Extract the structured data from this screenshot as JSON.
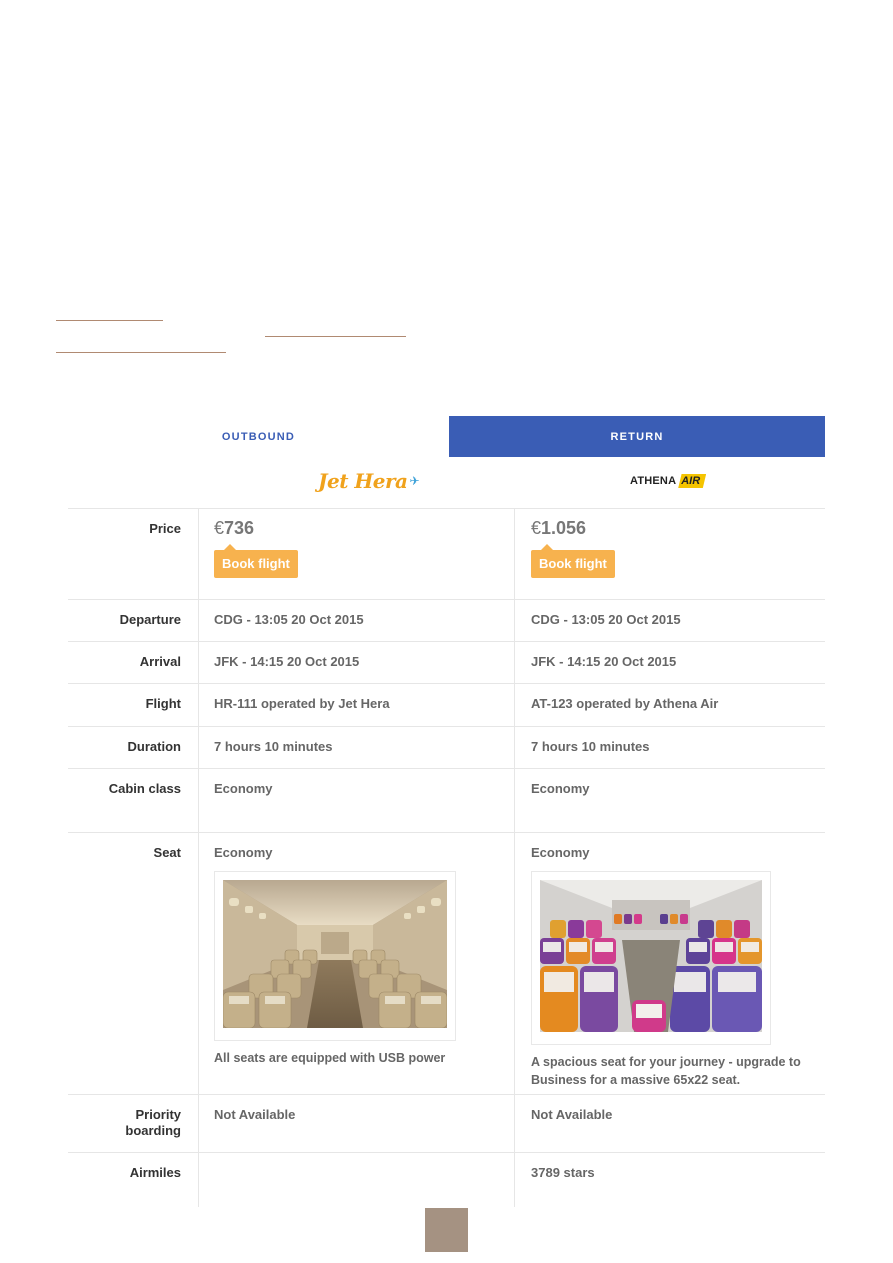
{
  "tabs": {
    "outbound": "OUTBOUND",
    "return": "RETURN"
  },
  "airlines": {
    "jet_hera": "Jet Hera",
    "athena_main": "ATHENA",
    "athena_accent": "AIR"
  },
  "rows": {
    "price": {
      "label": "Price",
      "col1_currency": "€",
      "col1_amount": "736",
      "col2_currency": "€",
      "col2_amount": "1.056",
      "book_label": "Book flight"
    },
    "departure": {
      "label": "Departure",
      "col1": "CDG - 13:05 20 Oct 2015",
      "col2": "CDG - 13:05 20 Oct 2015"
    },
    "arrival": {
      "label": "Arrival",
      "col1": "JFK - 14:15 20 Oct 2015",
      "col2": "JFK - 14:15 20 Oct 2015"
    },
    "flight": {
      "label": "Flight",
      "col1": "HR-111 operated by Jet Hera",
      "col2": "AT-123 operated by Athena Air"
    },
    "duration": {
      "label": "Duration",
      "col1": "7 hours 10 minutes",
      "col2": "7 hours 10 minutes"
    },
    "cabin_class": {
      "label": "Cabin class",
      "col1": "Economy",
      "col2": "Economy"
    },
    "seat": {
      "label": "Seat",
      "col1": "Economy",
      "col1_caption": "All seats are equipped with USB power",
      "col2": "Economy",
      "col2_caption": "A spacious seat for your journey - upgrade to Business for a massive 65x22 seat."
    },
    "priority_boarding": {
      "label": "Priority boarding",
      "col1": "Not Available",
      "col2": "Not Available"
    },
    "airmiles": {
      "label": "Airmiles",
      "col1": "",
      "col2": "3789 stars"
    }
  },
  "colors": {
    "accent_blue": "#3a5db5",
    "book_orange": "#f7b24e",
    "link_brown": "#b08a72",
    "square": "#a59282"
  }
}
